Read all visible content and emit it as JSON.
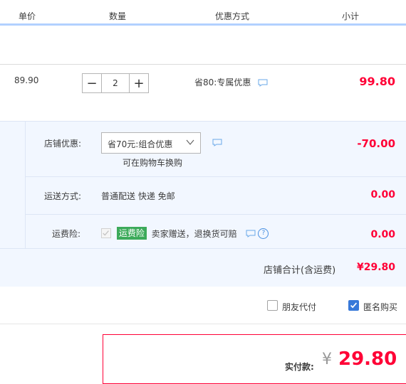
{
  "header": {
    "col_price": "单价",
    "col_qty": "数量",
    "col_promo": "优惠方式",
    "col_subtotal": "小计"
  },
  "item": {
    "price": "89.90",
    "qty_minus": "−",
    "qty_value": "2",
    "qty_plus": "+",
    "promo": "省80:专属优惠",
    "subtotal": "99.80"
  },
  "shop": {
    "discount_label": "店铺优惠:",
    "discount_select": "省70元:组合优惠",
    "discount_link": "可在购物车换购",
    "discount_amount": "-70.00",
    "shipping_label": "运送方式:",
    "shipping_value": "普通配送 快递 免邮",
    "shipping_amount": "0.00",
    "insurance_label": "运费险:",
    "insurance_badge": "运费险",
    "insurance_text": "卖家赠送，退换货可赔",
    "insurance_amount": "0.00",
    "total_label": "店铺合计(含运费)",
    "total_amount": "¥29.80"
  },
  "options": {
    "friend_pay": "朋友代付",
    "anonymous": "匿名购买",
    "friend_pay_checked": false,
    "anonymous_checked": true
  },
  "pay": {
    "label": "实付款:",
    "currency": "¥",
    "amount": "29.80"
  },
  "colors": {
    "accent_red": "#ff0036",
    "link_blue": "#3879d9",
    "panel_bg": "#f2f7ff",
    "badge_green": "#3caa5a"
  },
  "icons": [
    "chat-bubble-icon",
    "chevron-down-icon",
    "question-icon",
    "check-icon"
  ]
}
